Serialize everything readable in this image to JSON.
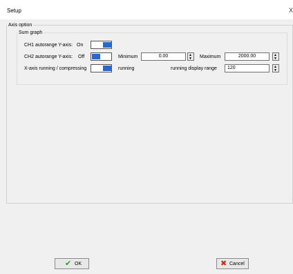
{
  "window": {
    "title": "Setup",
    "close_glyph": "X"
  },
  "axis_option": {
    "legend": "Axis option",
    "sum_graph": {
      "legend": "Sum graph",
      "ch1": {
        "label": "CH1 autorange Y-axis:",
        "state": "On"
      },
      "ch2": {
        "label": "CH2 autorange Y-axis:",
        "state": "Off",
        "minimum_label": "Minimum",
        "minimum_value": "0.00",
        "maximum_label": "Maximum",
        "maximum_value": "2000.00"
      },
      "xaxis": {
        "label": "X-axis running / compressing",
        "state": "running",
        "range_label": "running display range",
        "range_value": "120"
      }
    }
  },
  "buttons": {
    "ok": {
      "label": "OK",
      "icon": "check-icon"
    },
    "cancel": {
      "label": "Cancel",
      "icon": "x-icon"
    }
  },
  "colors": {
    "toggle_knob": "#2a69c9",
    "ok_check": "#2e9a2e",
    "cancel_x": "#d12a1a"
  }
}
